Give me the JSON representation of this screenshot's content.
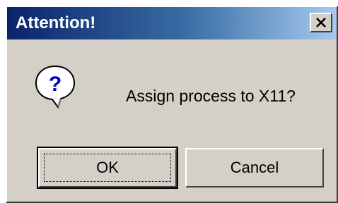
{
  "window": {
    "title": "Attention!",
    "close_glyph": "✕"
  },
  "dialog": {
    "icon": "question-icon",
    "message": "Assign process to X11?"
  },
  "buttons": {
    "ok_label": "OK",
    "cancel_label": "Cancel"
  },
  "colors": {
    "title_start": "#0a246a",
    "title_end": "#a6caf0",
    "face": "#d4d0c8"
  }
}
